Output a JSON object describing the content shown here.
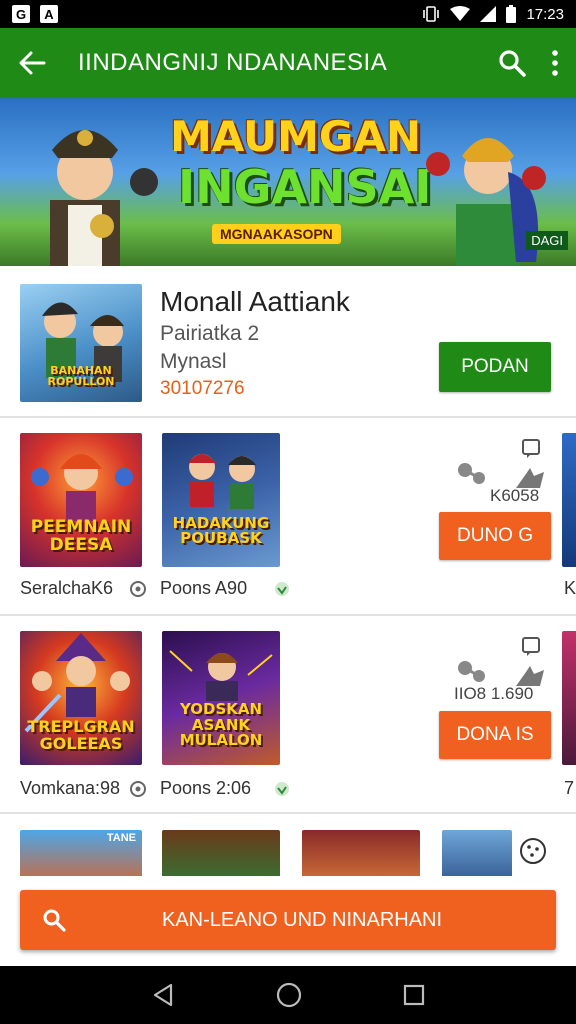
{
  "statusbar": {
    "left_icons": [
      "G",
      "A"
    ],
    "time": "17:23"
  },
  "appbar": {
    "title": "IINDANGNIJ NDANANESIA"
  },
  "banner": {
    "title_line1": "MAUMGAN",
    "title_line2": "INGANSAI",
    "subtitle": "MGNAAKASOPN",
    "tag": "DAGI"
  },
  "featured": {
    "thumb_label": "BANAHAN ROPULLON",
    "name": "Monall Aattiank",
    "line1": "Pairiatka 2",
    "line2": "Mynasl",
    "price": "30107276",
    "button_label": "PODAN"
  },
  "rows": [
    {
      "thumb1_label": "PEEMNAIN DEESA",
      "thumb2_label": "HADAKUNG POUBASK",
      "caption1": "SeralchaK6",
      "caption2": "Poons A90",
      "stat_text": "K6058",
      "button_label": "DUNO G"
    },
    {
      "thumb1_label": "TREPLGRAN GOLEEAS",
      "thumb2_label": "YODSKAN ASANK MULALON",
      "caption1": "Vomkana:98",
      "caption2": "Poons 2:06",
      "stat_text": "IIO8 1.690",
      "button_label": "DONA IS"
    }
  ],
  "row2_thumb_tag": "TANE",
  "row_edge_captions": [
    "K",
    "7"
  ],
  "search_button_label": "KAN-LEANO UND NINARHANI",
  "colors": {
    "primary_green": "#1f8a15",
    "accent_orange": "#f0611f",
    "price_orange": "#e2611b"
  }
}
